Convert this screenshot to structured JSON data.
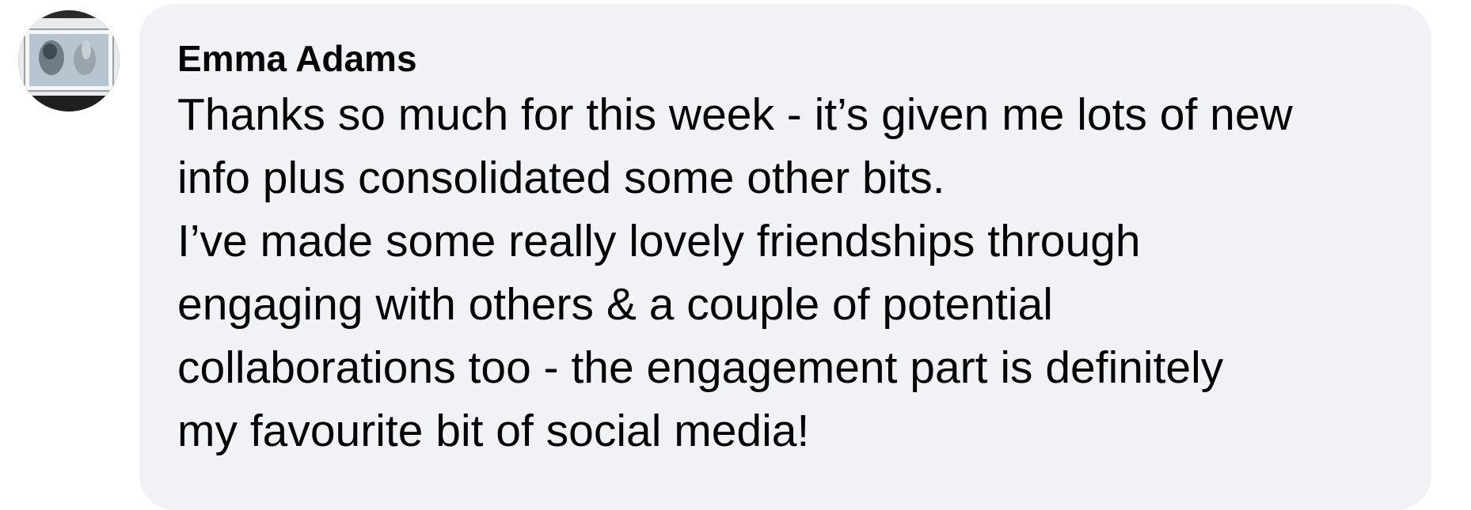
{
  "comment": {
    "author": "Emma Adams",
    "avatar": "avatar-artwork-photo",
    "lines": [
      "Thanks so much for this week - it’s given me lots of new",
      "info plus consolidated some other bits.",
      "I’ve made some really lovely friendships through",
      "engaging with others & a couple of potential",
      "collaborations too - the engagement part is definitely",
      "my favourite bit of social media!"
    ]
  },
  "colors": {
    "bubble": "#f0f2f5",
    "text": "#050505"
  }
}
